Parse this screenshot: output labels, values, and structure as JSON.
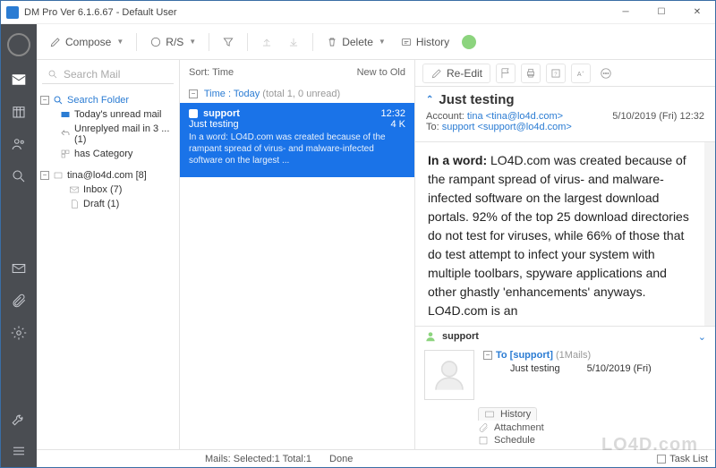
{
  "window": {
    "title": "DM Pro Ver 6.1.6.67  -  Default User"
  },
  "toolbar": {
    "compose": "Compose",
    "rs": "R/S",
    "delete": "Delete",
    "history": "History"
  },
  "search": {
    "placeholder": "Search Mail"
  },
  "folders": {
    "search_folder": "Search Folder",
    "todays_unread": "Today's unread mail",
    "unreplied": "Unreplyed mail in 3 ... (1)",
    "has_category": "has Category",
    "account": "tina@lo4d.com [8]",
    "inbox": "Inbox (7)",
    "draft": "Draft (1)"
  },
  "msglist": {
    "sort_label": "Sort: Time",
    "order_label": "New to Old",
    "group_label": "Time : Today",
    "group_count": "(total 1, 0 unread)",
    "item": {
      "from": "support",
      "time": "12:32",
      "subject": "Just testing",
      "size": "4 K",
      "preview": "In a word: LO4D.com was created because of the rampant spread of virus- and malware-infected software on the largest ..."
    }
  },
  "preview": {
    "reedit": "Re-Edit",
    "subject": "Just testing",
    "account_label": "Account:",
    "account_value": "tina <tina@lo4d.com>",
    "to_label": "To:",
    "to_value": "support <support@lo4d.com>",
    "datetime": "5/10/2019 (Fri) 12:32",
    "body_bold": "In a word:",
    "body_text": " LO4D.com was created because of the rampant spread of virus- and malware-infected software on the largest download portals. 92% of the top 25 download directories do not test for viruses, while 66% of those that do test attempt to infect your system with multiple toolbars, spyware applications and other ghastly 'enhancements' anyways. LO4D.com is an",
    "sender_panel": {
      "name": "support",
      "to_line": "To [support]",
      "to_count": "(1Mails)",
      "mail_subject": "Just testing",
      "mail_date": "5/10/2019 (Fri)",
      "tab_history": "History",
      "tab_attachment": "Attachment",
      "tab_schedule": "Schedule"
    }
  },
  "statusbar": {
    "mails": "Mails: Selected:1 Total:1",
    "done": "Done",
    "tasklist": "Task List"
  },
  "watermark": "LO4D.com"
}
